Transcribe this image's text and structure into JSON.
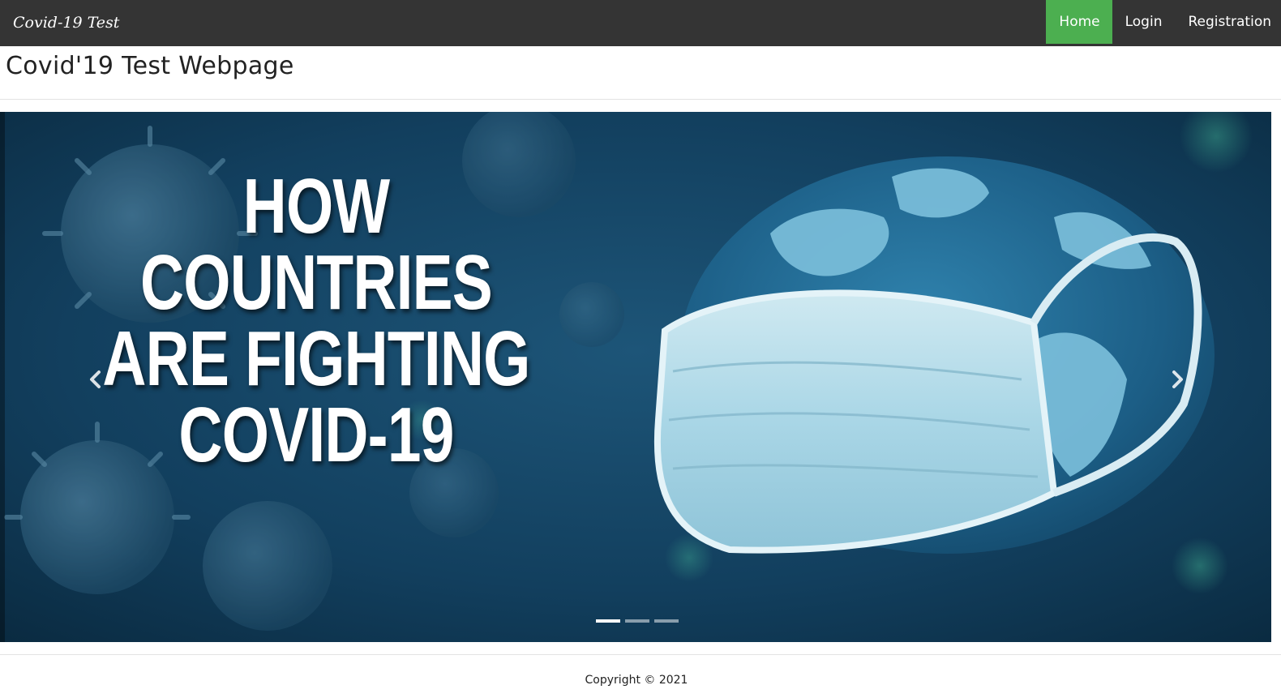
{
  "navbar": {
    "brand": "Covid-19 Test",
    "items": [
      {
        "label": "Home",
        "active": true
      },
      {
        "label": "Login",
        "active": false
      },
      {
        "label": "Registration",
        "active": false
      }
    ],
    "active_color": "#4caf50",
    "background_color": "#343434"
  },
  "page": {
    "title": "Covid'19 Test Webpage"
  },
  "carousel": {
    "slide_text_lines": [
      "HOW",
      "COUNTRIES",
      "ARE FIGHTING",
      "COVID-19"
    ],
    "prev_icon": "chevron-left-icon",
    "next_icon": "chevron-right-icon",
    "slide_count": 3,
    "active_slide": 1
  },
  "footer": {
    "copyright": "Copyright © 2021"
  }
}
